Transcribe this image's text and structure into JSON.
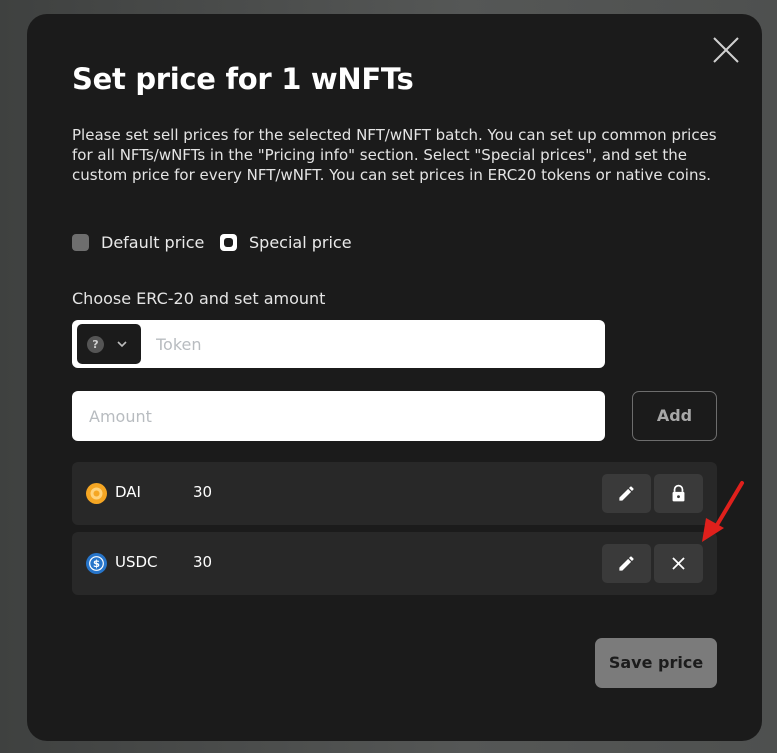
{
  "modal": {
    "title": "Set price for 1 wNFTs",
    "description": "Please set sell prices for the selected NFT/wNFT batch. You can set up common prices for all NFTs/wNFTs in the \"Pricing info\" section. Select \"Special prices\", and set the custom price for every NFT/wNFT. You can set prices in ERC20 tokens or native coins.",
    "price_mode": {
      "options": [
        {
          "label": "Default price",
          "selected": false
        },
        {
          "label": "Special price",
          "selected": true
        }
      ]
    },
    "erc20_section_label": "Choose ERC-20 and set amount",
    "token_field": {
      "placeholder": "Token",
      "value": ""
    },
    "amount_field": {
      "placeholder": "Amount",
      "value": ""
    },
    "add_button": "Add",
    "prices": [
      {
        "token": "DAI",
        "amount": "30",
        "icon": "dai-coin-icon",
        "icon_color": "#f5a623",
        "side_action": "lock-icon"
      },
      {
        "token": "USDC",
        "amount": "30",
        "icon": "usdc-coin-icon",
        "icon_color": "#2775ca",
        "side_action": "close-icon"
      }
    ],
    "save_button": "Save price"
  },
  "colors": {
    "modal_bg": "#1b1b1b",
    "row_bg": "#282828",
    "annotation_arrow": "#e0201c"
  }
}
